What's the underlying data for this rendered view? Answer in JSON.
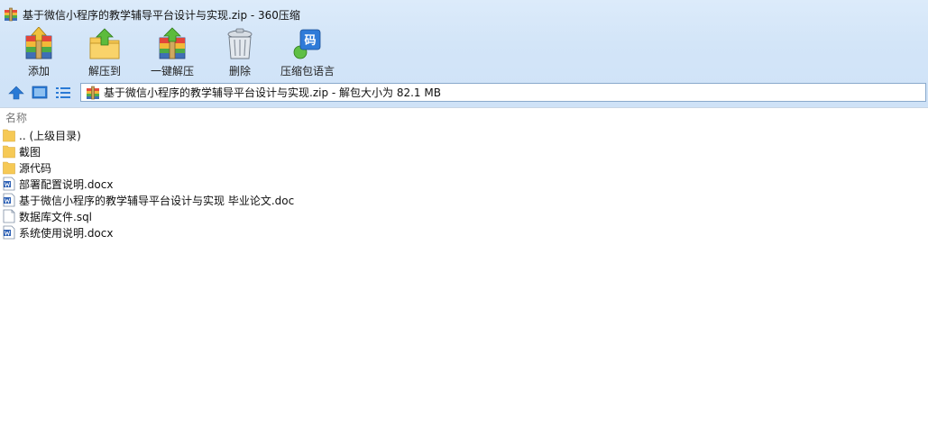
{
  "window": {
    "title": "基于微信小程序的教学辅导平台设计与实现.zip - 360压缩"
  },
  "toolbar": {
    "items": [
      {
        "label": "添加",
        "icon": "add-archive-icon"
      },
      {
        "label": "解压到",
        "icon": "extract-to-icon"
      },
      {
        "label": "一键解压",
        "icon": "one-click-extract-icon"
      },
      {
        "label": "删除",
        "icon": "delete-trash-icon"
      },
      {
        "label": "压缩包语言",
        "icon": "archive-language-icon",
        "glyph": "码"
      }
    ]
  },
  "address": {
    "path": "基于微信小程序的教学辅导平台设计与实现.zip - 解包大小为 82.1 MB"
  },
  "list": {
    "column_name": "名称",
    "items": [
      {
        "name": ".. (上级目录)",
        "type": "folder"
      },
      {
        "name": "截图",
        "type": "folder"
      },
      {
        "name": "源代码",
        "type": "folder"
      },
      {
        "name": "部署配置说明.docx",
        "type": "word"
      },
      {
        "name": "基于微信小程序的教学辅导平台设计与实现 毕业论文.doc",
        "type": "word"
      },
      {
        "name": "数据库文件.sql",
        "type": "file"
      },
      {
        "name": "系统使用说明.docx",
        "type": "word"
      }
    ]
  },
  "colors": {
    "chrome_bg": "#d3e5f8",
    "folder": "#f6c955",
    "word_blue": "#2b5fb4",
    "nav_blue": "#2a7ad5"
  }
}
